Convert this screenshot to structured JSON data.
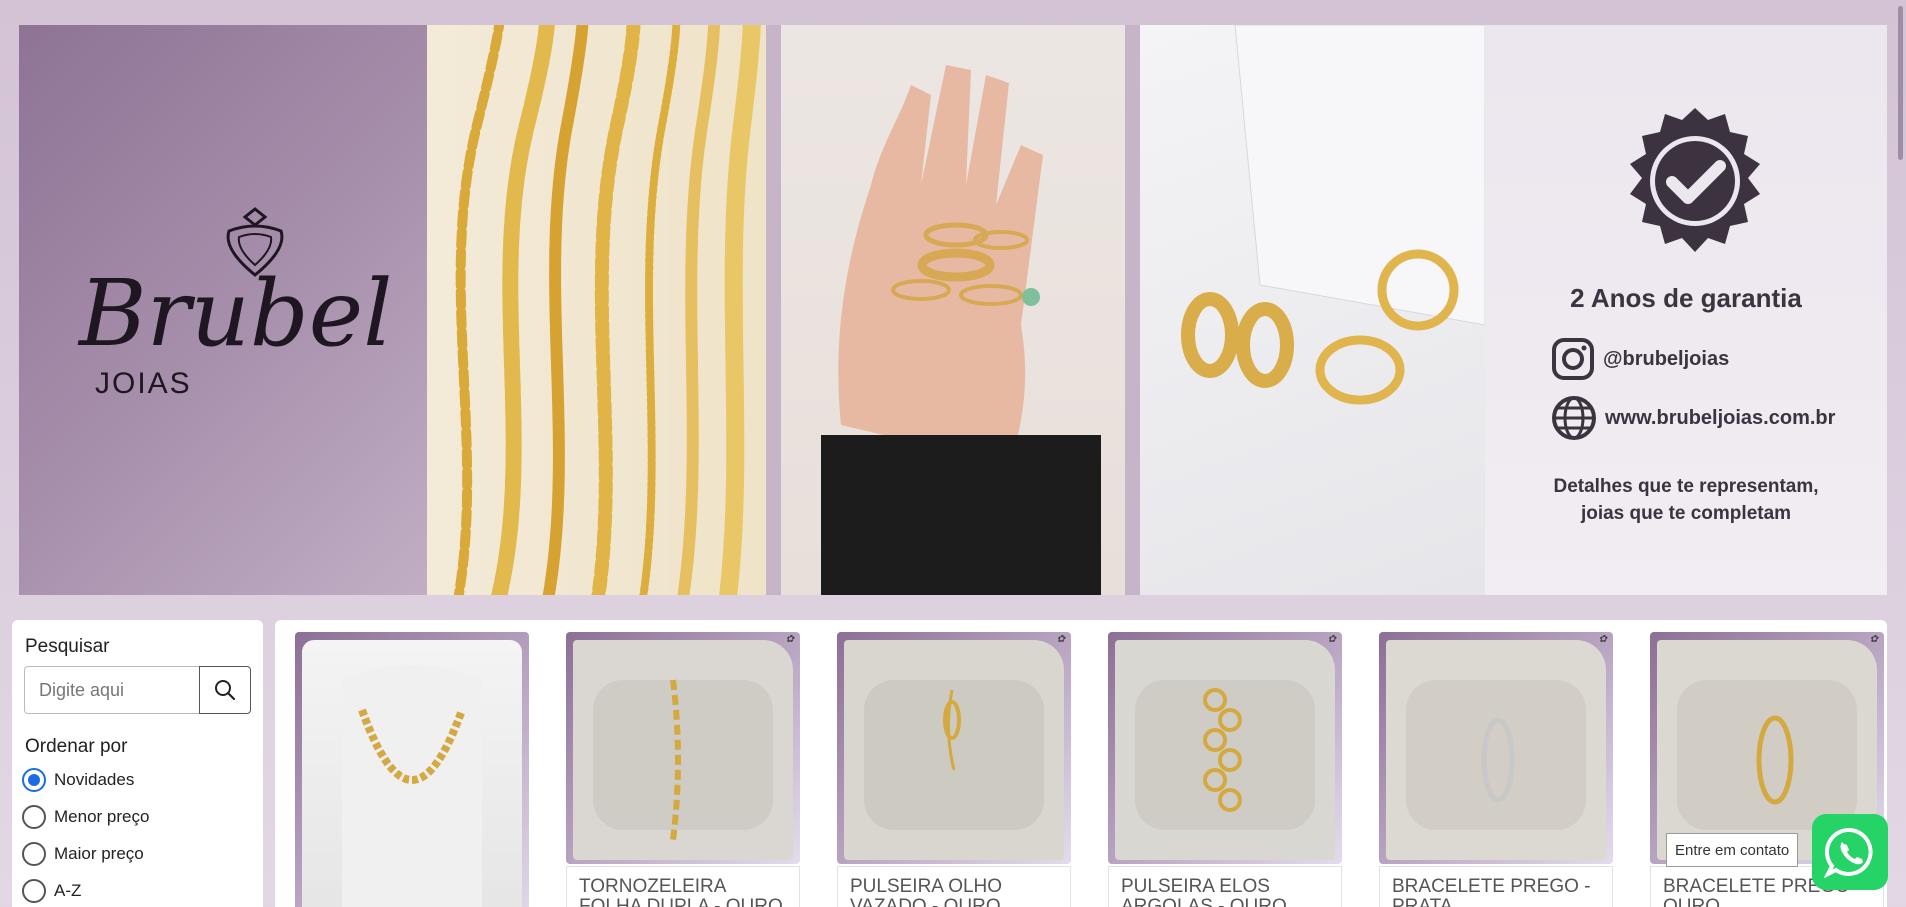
{
  "banner": {
    "logo_script": "Brubel",
    "logo_sub": "JOIAS",
    "warranty": "2 Anos de garantia",
    "instagram": "@brubeljoias",
    "website": "www.brubeljoias.com.br",
    "slogan_line1": "Detalhes que te representam,",
    "slogan_line2": "joias que te completam"
  },
  "filters": {
    "search_label": "Pesquisar",
    "search_placeholder": "Digite aqui",
    "sort_label": "Ordenar por",
    "sort_options": [
      "Novidades",
      "Menor preço",
      "Maior preço",
      "A-Z"
    ],
    "selected_sort": "Novidades"
  },
  "products": [
    {
      "name": ""
    },
    {
      "name": "TORNOZELEIRA FOLHA DUPLA - OURO"
    },
    {
      "name": "PULSEIRA OLHO VAZADO - OURO"
    },
    {
      "name": "PULSEIRA ELOS ARGOLAS - OURO"
    },
    {
      "name": "BRACELETE PREGO - PRATA"
    },
    {
      "name": "BRACELETE PREGO - OURO"
    }
  ],
  "contact_tooltip": "Entre em contato",
  "icons": {
    "search": "search-icon",
    "whatsapp": "whatsapp-icon",
    "instagram": "instagram-icon",
    "globe": "globe-icon",
    "badge": "check-badge-icon"
  },
  "colors": {
    "brand_purple": "#8e7395",
    "whatsapp_green": "#25d366",
    "radio_selected": "#1a6ee0"
  }
}
